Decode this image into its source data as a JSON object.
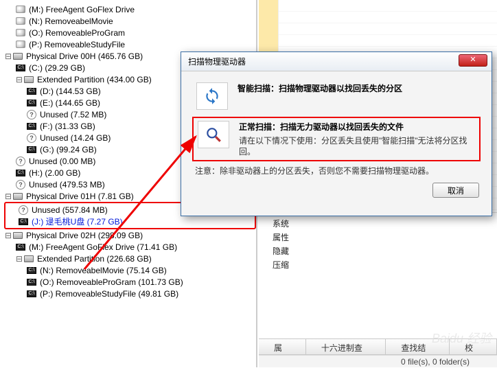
{
  "tree": {
    "m": "(M:) FreeAgent GoFlex Drive",
    "n": "(N:) RemoveabelMovie",
    "o": "(O:) RemoveableProGram",
    "p": "(P:) RemoveableStudyFile",
    "phys0": "Physical Drive 00H (465.76 GB)",
    "c": "(C:)  (29.29 GB)",
    "ext0": "Extended Partition (434.00 GB)",
    "d": "(D:)  (144.53 GB)",
    "e": "(E:)  (144.65 GB)",
    "u1": "Unused (7.52 MB)",
    "f": "(F:)  (31.33 GB)",
    "u2": "Unused (14.24 GB)",
    "g": "(G:)  (99.24 GB)",
    "u3": "Unused (0.00 MB)",
    "h": "(H:)  (2.00 GB)",
    "u4": "Unused (479.53 MB)",
    "phys1": "Physical Drive 01H (7.81 GB)",
    "u5": "Unused (557.84 MB)",
    "j": "(J:) 逯毛桃U盘 (7.27 GB)",
    "phys2": "Physical Drive 02H (298.09 GB)",
    "m2": "(M:) FreeAgent GoFlex Drive (71.41 GB)",
    "ext2": "Extended Partition (226.68 GB)",
    "n2": "(N:) RemoveabelMovie (75.14 GB)",
    "o2": "(O:) RemoveableProGram (101.73 GB)",
    "p2": "(P:) RemoveableStudyFile (49.81 GB)"
  },
  "info": {
    "i1": "系统",
    "i2": "属性",
    "i3": "隐藏",
    "i4": "压缩"
  },
  "tabs": {
    "t1": "属性",
    "t2": "十六进制查看",
    "t3": "查找结果",
    "t4": "校对"
  },
  "status": "0 file(s), 0 folder(s)",
  "dialog": {
    "title": "扫描物理驱动器",
    "smart_title": "智能扫描：扫描物理驱动器以找回丢失的分区",
    "normal_title": "正常扫描：扫描无力驱动器以找回丢失的文件",
    "normal_desc": "请在以下情况下使用：分区丢失且使用\"智能扫描\"无法将分区找回。",
    "note": "注意：除非驱动器上的分区丢失，否则您不需要扫描物理驱动器。",
    "cancel": "取消"
  },
  "watermark": "Baidu 经验"
}
